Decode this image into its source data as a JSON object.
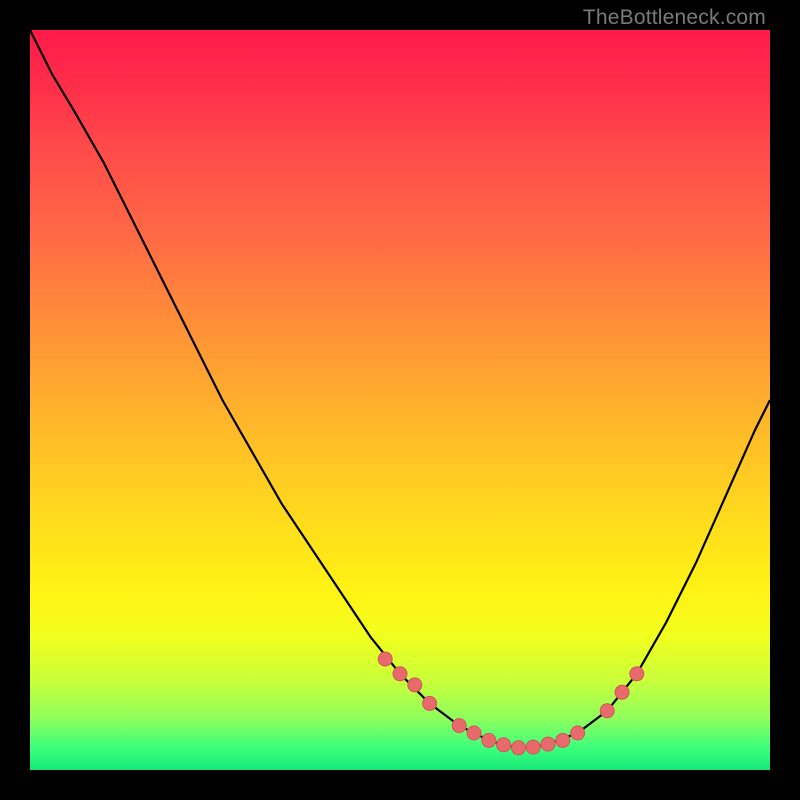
{
  "watermark": "TheBottleneck.com",
  "chart_data": {
    "type": "line",
    "title": "",
    "xlabel": "",
    "ylabel": "",
    "xlim": [
      0,
      100
    ],
    "ylim": [
      0,
      100
    ],
    "series": [
      {
        "name": "bottleneck-curve",
        "x": [
          0,
          3,
          6,
          10,
          14,
          18,
          22,
          26,
          30,
          34,
          38,
          42,
          46,
          50,
          54,
          58,
          62,
          64,
          66,
          68,
          70,
          74,
          78,
          82,
          86,
          90,
          94,
          98,
          100
        ],
        "y": [
          100,
          94,
          89,
          82,
          74,
          66,
          58,
          50,
          43,
          36,
          30,
          24,
          18,
          13,
          9,
          6,
          4,
          3.4,
          3,
          3.1,
          3.5,
          5,
          8,
          13,
          20,
          28,
          37,
          46,
          50
        ]
      }
    ],
    "marker_points": {
      "name": "highlight-points",
      "x": [
        48,
        50,
        52,
        54,
        58,
        60,
        62,
        64,
        66,
        68,
        70,
        72,
        74,
        78,
        80,
        82
      ],
      "y": [
        15,
        13,
        11.5,
        9,
        6,
        5,
        4,
        3.4,
        3,
        3.1,
        3.5,
        4,
        5,
        8,
        10.5,
        13
      ]
    },
    "colors": {
      "curve": "#000000",
      "marker_fill": "#e86a6a",
      "marker_stroke": "#d05858",
      "gradient_top": "#ff1a49",
      "gradient_bottom": "#16e879"
    }
  }
}
